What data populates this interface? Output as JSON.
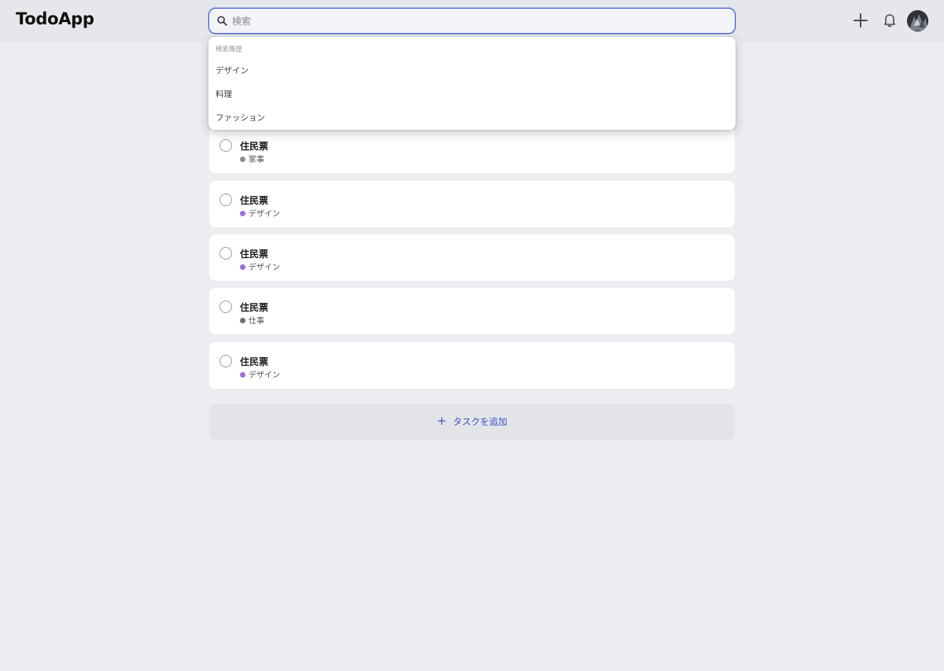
{
  "app": {
    "name": "TodoApp"
  },
  "search": {
    "placeholder": "検索",
    "value": "",
    "icon": "search-icon",
    "focus_color": "#3b5bd6"
  },
  "header_actions": [
    {
      "icon": "plus-icon",
      "label": ""
    },
    {
      "icon": "bell-icon",
      "label": ""
    }
  ],
  "search_history": {
    "heading": "検索履歴",
    "items": [
      "デザイン",
      "料理",
      "ファッション"
    ]
  },
  "tasks": [
    {
      "title": "住民票",
      "tag": "家事",
      "tag_color": "#8c8e95"
    },
    {
      "title": "住民票",
      "tag": "デザイン",
      "tag_color": "#9b6fe0"
    },
    {
      "title": "住民票",
      "tag": "デザイン",
      "tag_color": "#9b6fe0"
    },
    {
      "title": "住民票",
      "tag": "仕事",
      "tag_color": "#6e7077"
    },
    {
      "title": "住民票",
      "tag": "デザイン",
      "tag_color": "#9b6fe0"
    }
  ],
  "add_task": {
    "label": "タスクを追加",
    "color": "#3652c4"
  }
}
